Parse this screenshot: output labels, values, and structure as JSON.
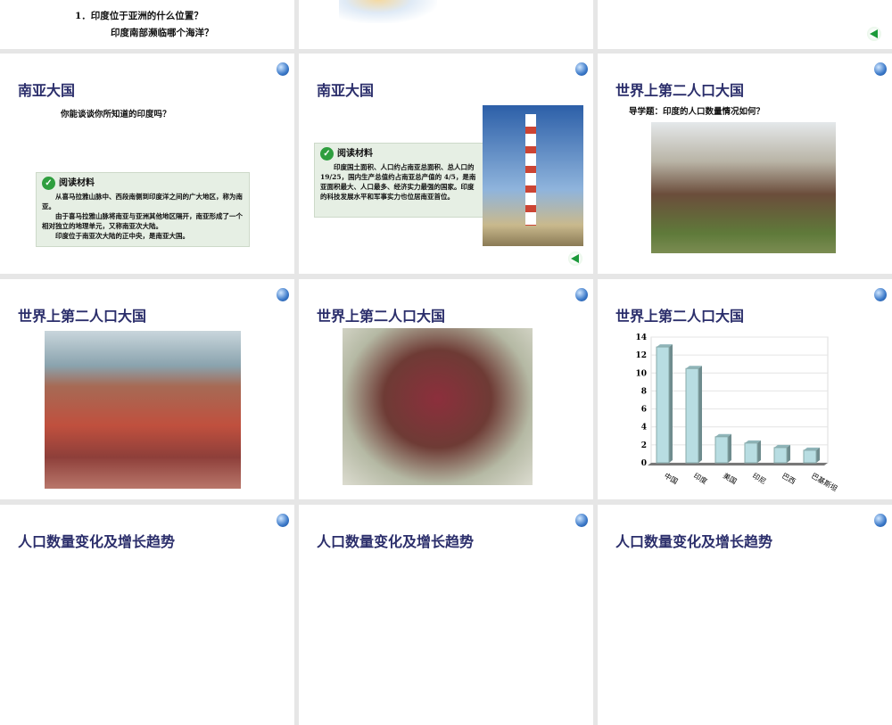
{
  "slides": [
    {
      "id": "s0a",
      "lines": [
        "1．印度位于亚洲的什么位置？",
        "印度南部濒临哪个海洋？"
      ]
    },
    {
      "id": "s0b"
    },
    {
      "id": "s0c"
    },
    {
      "id": "s1",
      "title": "南亚大国",
      "question": "你能谈谈你所知道的印度吗？",
      "box_title": "阅读材料",
      "box_paras": [
        "从喜马拉雅山脉中、西段南侧到印度洋之间的广大地区，称为南亚。",
        "由于喜马拉雅山脉将南亚与亚洲其他地区隔开，南亚形成了一个相对独立的地理单元，又称南亚次大陆。",
        "印度位于南亚次大陆的正中央，是南亚大国。"
      ]
    },
    {
      "id": "s2",
      "title": "南亚大国",
      "box_title": "阅读材料",
      "box_text": "印度国土面积、人口约占南亚总面积、总人口的 19/25，国内生产总值约占南亚总产值的 4/5，是南亚面积最大、人口最多、经济实力最强的国家。印度的科技发展水平和军事实力也位居南亚首位。"
    },
    {
      "id": "s3",
      "title": "世界上第二人口大国",
      "question": "导学题：印度的人口数量情况如何？"
    },
    {
      "id": "s4",
      "title": "世界上第二人口大国"
    },
    {
      "id": "s5",
      "title": "世界上第二人口大国"
    },
    {
      "id": "s6",
      "title": "世界上第二人口大国"
    },
    {
      "id": "s7",
      "title": "人口数量变化及增长趋势"
    },
    {
      "id": "s8",
      "title": "人口数量变化及增长趋势"
    },
    {
      "id": "s9",
      "title": "人口数量变化及增长趋势"
    }
  ],
  "chart_data": {
    "type": "bar",
    "categories": [
      "中国",
      "印度",
      "美国",
      "印尼",
      "巴西",
      "巴基斯坦"
    ],
    "values": [
      12.9,
      10.5,
      2.9,
      2.2,
      1.7,
      1.4
    ],
    "ylim": [
      0,
      14
    ],
    "yticks": [
      0,
      2,
      4,
      6,
      8,
      10,
      12,
      14
    ],
    "title": "",
    "xlabel": "",
    "ylabel": "",
    "colors": {
      "bar": "#b8dde2",
      "side": "#6f8c8e"
    }
  }
}
